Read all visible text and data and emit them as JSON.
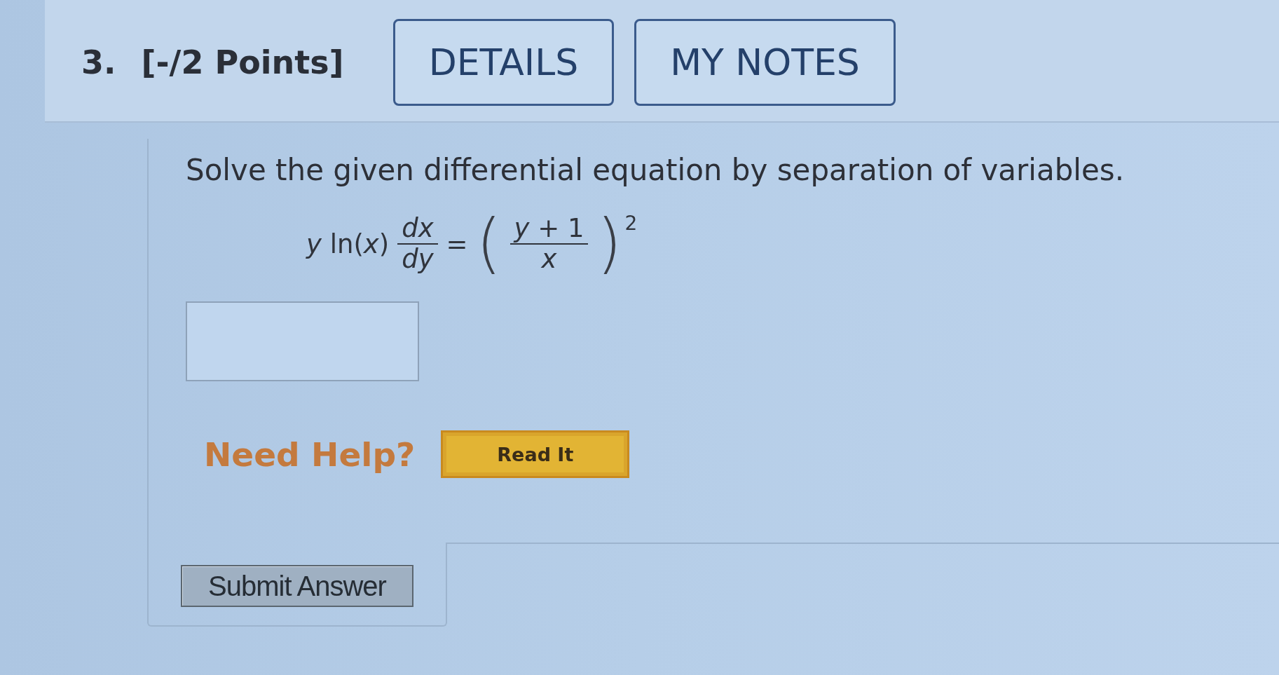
{
  "question": {
    "number": "3.",
    "points": "[-/2 Points]",
    "header_buttons": [
      "DETAILS",
      "MY NOTES"
    ]
  },
  "prompt": "Solve the given differential equation by separation of variables.",
  "equation": {
    "lhs": "*y* ln(*x*)",
    "lhs_fraction": {
      "numerator": "dx",
      "denominator": "dy"
    },
    "relation": "=",
    "rhs_open": "(",
    "rhs_fraction": {
      "numerator": "*y* + 1",
      "denominator": "x"
    },
    "rhs_close": ")",
    "exponent": "2"
  },
  "help": {
    "label": "Need Help?",
    "buttons": [
      "Read It"
    ]
  },
  "submit": {
    "label": "Submit Answer"
  }
}
